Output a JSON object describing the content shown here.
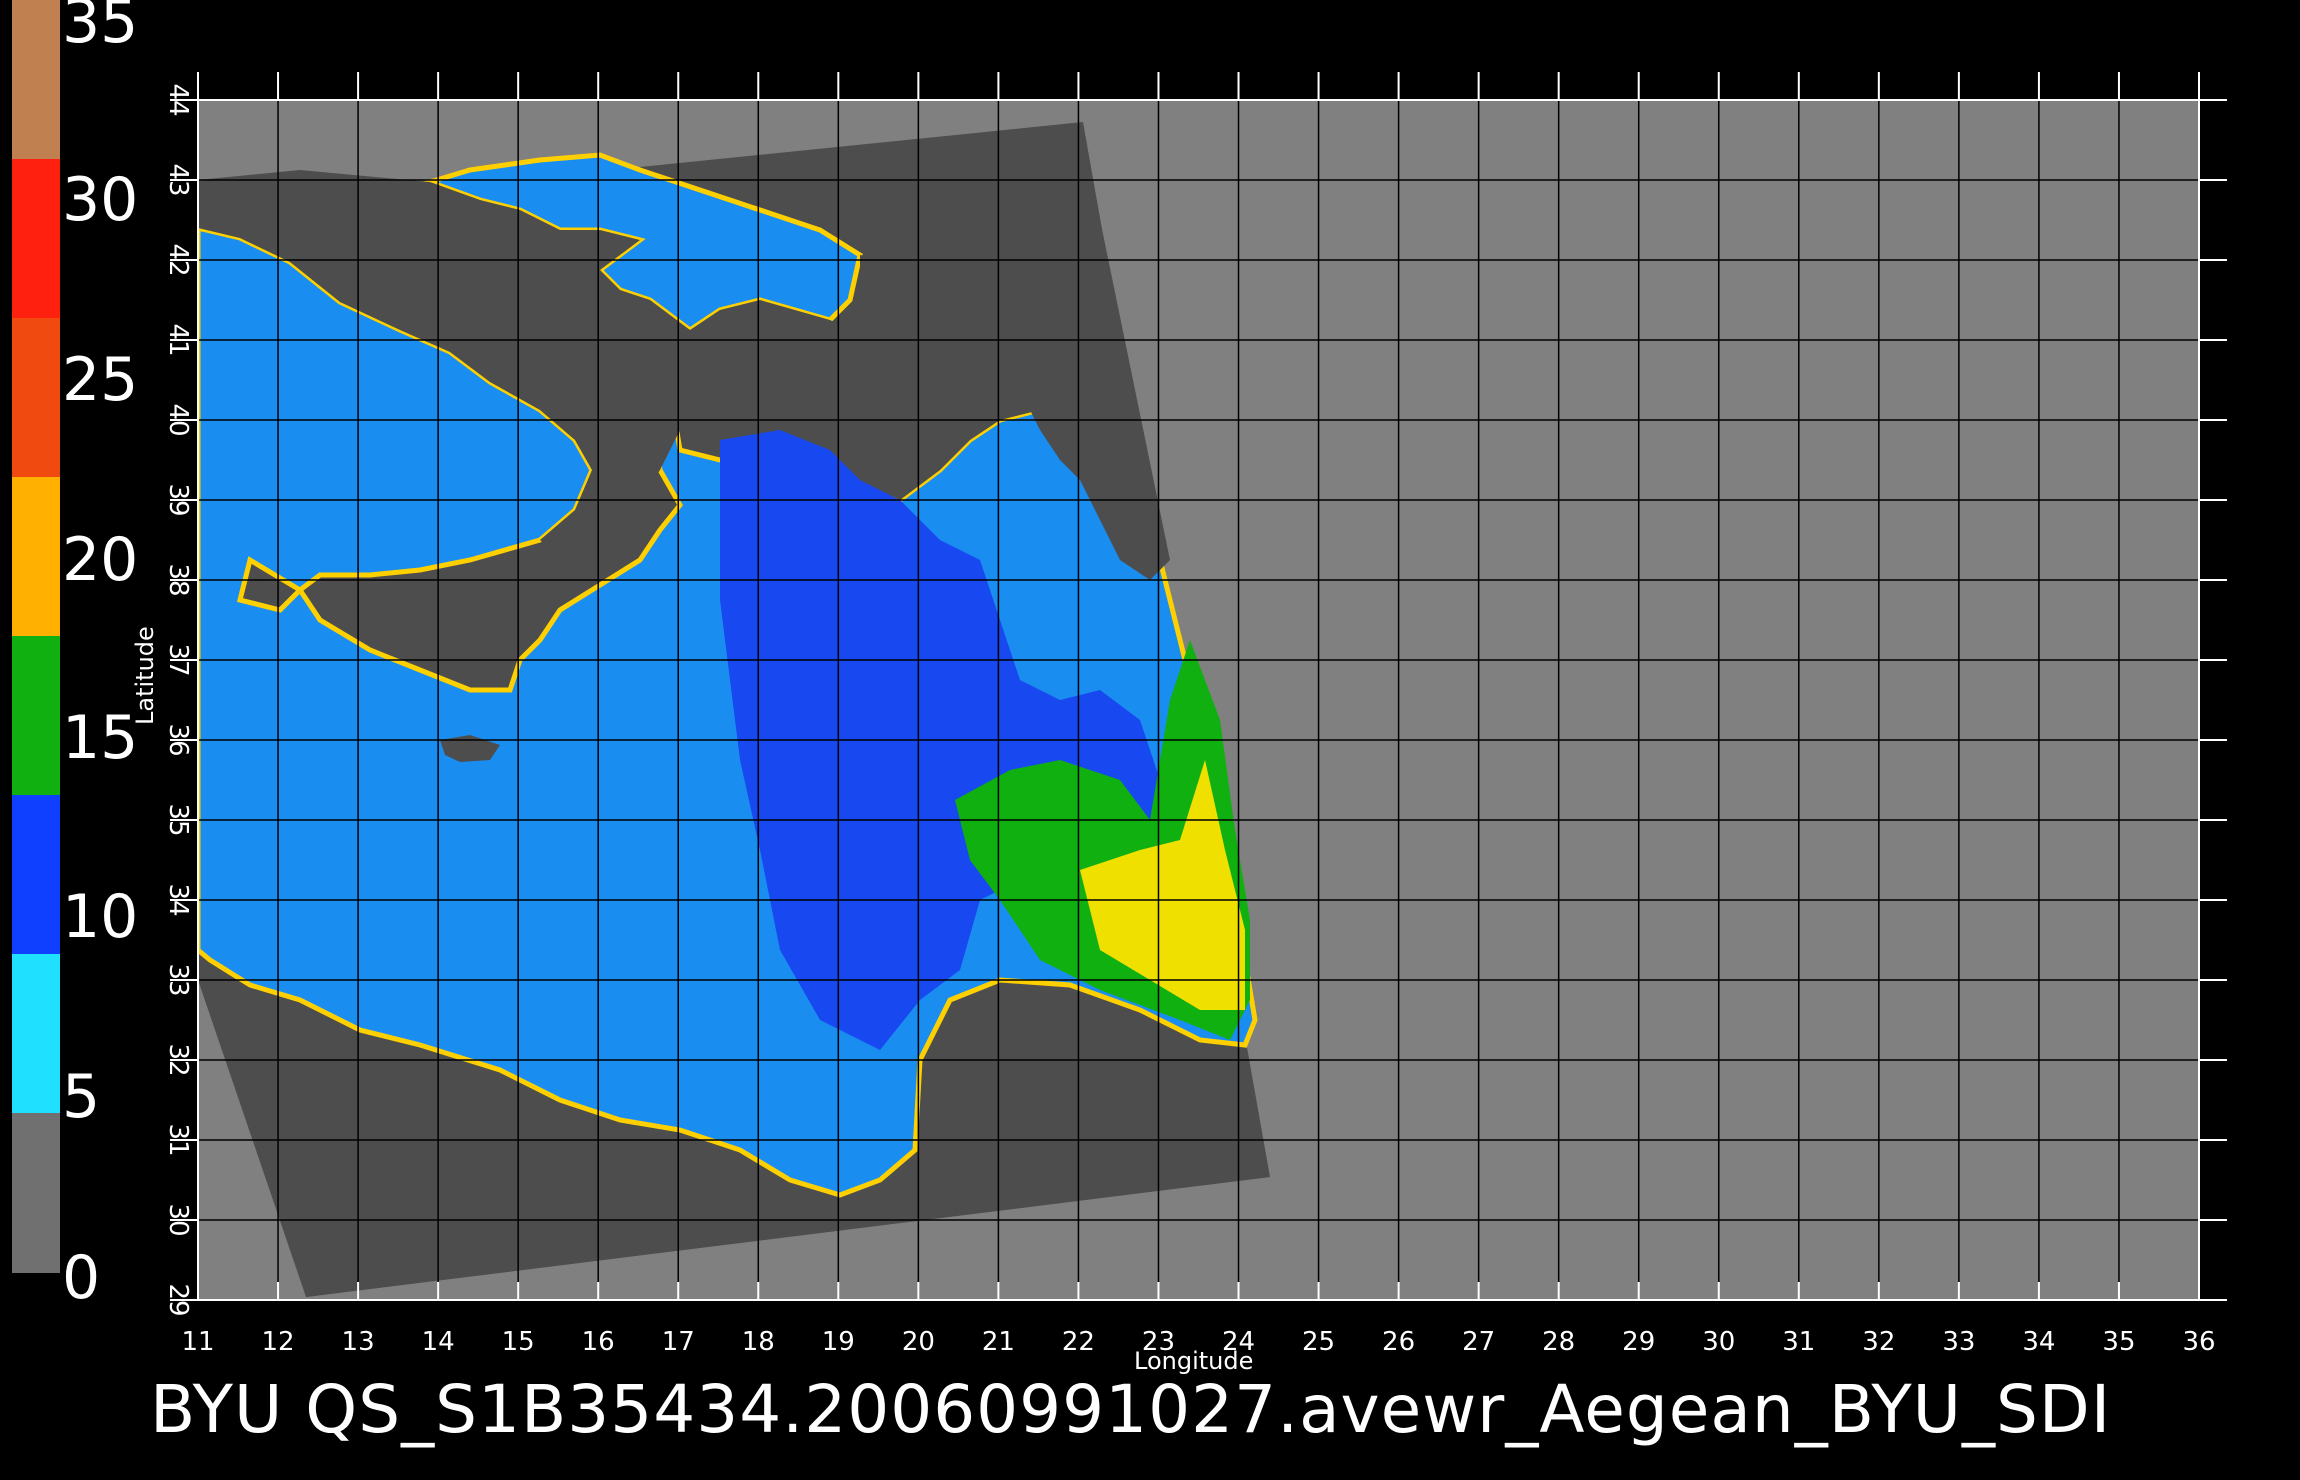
{
  "colorbar": {
    "labels": [
      "35",
      "30",
      "25",
      "20",
      "15",
      "10",
      "5",
      "0"
    ],
    "bands": [
      {
        "color": "#c08050"
      },
      {
        "color": "#ff2010"
      },
      {
        "color": "#f04a10"
      },
      {
        "color": "#ffb000"
      },
      {
        "color": "#10b010"
      },
      {
        "color": "#1040ff"
      },
      {
        "color": "#20e0ff"
      },
      {
        "color": "#707070"
      }
    ]
  },
  "axes": {
    "xlabel": "Longitude",
    "ylabel": "Latitude",
    "xticks": [
      "11",
      "12",
      "13",
      "14",
      "15",
      "16",
      "17",
      "18",
      "19",
      "20",
      "21",
      "22",
      "23",
      "24",
      "25",
      "26",
      "27",
      "28",
      "29",
      "30",
      "31",
      "32",
      "33",
      "34",
      "35",
      "36"
    ],
    "yticks": [
      "29",
      "30",
      "31",
      "32",
      "33",
      "34",
      "35",
      "36",
      "37",
      "38",
      "39",
      "40",
      "41",
      "42",
      "43",
      "44"
    ]
  },
  "footer": {
    "title": "BYU  QS_S1B35434.20060991027.avewr_Aegean_BYU_SDI"
  },
  "colors": {
    "background": "#000000",
    "no_data": "#808080",
    "swath": "#4d4d4d",
    "grid": "#000000"
  }
}
